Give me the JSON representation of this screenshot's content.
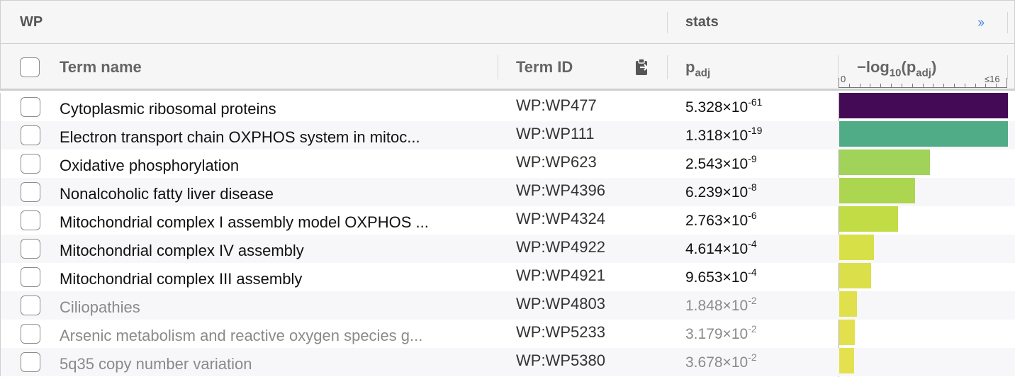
{
  "header": {
    "source_title": "WP",
    "stats_title": "stats",
    "expand_glyph": "››"
  },
  "columns": {
    "term_name": "Term name",
    "term_id": "Term ID",
    "padj_main": "p",
    "padj_sub": "adj",
    "log_main": "−log",
    "log_sub": "10",
    "log_open": "(p",
    "log_inner_sub": "adj",
    "log_close": ")",
    "axis_min": "0",
    "axis_max": "≤16"
  },
  "icons": {
    "clipboard": "clipboard-icon",
    "expand": "double-chevron-right-icon"
  },
  "chart_data": {
    "type": "bar",
    "axis_range": [
      0,
      16
    ],
    "bars": [
      {
        "term": "Cytoplasmic ribosomal proteins",
        "value": 16,
        "color": "#440a55"
      },
      {
        "term": "Electron transport chain OXPHOS system in mitoc...",
        "value": 16,
        "color": "#4fac87"
      },
      {
        "term": "Oxidative phosphorylation",
        "value": 8.6,
        "color": "#a1d25a"
      },
      {
        "term": "Nonalcoholic fatty liver disease",
        "value": 7.2,
        "color": "#acd64f"
      },
      {
        "term": "Mitochondrial complex I assembly model OXPHOS ...",
        "value": 5.6,
        "color": "#c2dc45"
      },
      {
        "term": "Mitochondrial complex IV assembly",
        "value": 3.3,
        "color": "#d7e047"
      },
      {
        "term": "Mitochondrial complex III assembly",
        "value": 3.0,
        "color": "#dbe04a"
      },
      {
        "term": "Ciliopathies",
        "value": 1.7,
        "color": "#e0e04c"
      },
      {
        "term": "Arsenic metabolism and reactive oxygen species g...",
        "value": 1.5,
        "color": "#e3e04e"
      },
      {
        "term": "5q35 copy number variation",
        "value": 1.4,
        "color": "#e4e150"
      }
    ]
  },
  "rows": [
    {
      "term": "Cytoplasmic ribosomal proteins",
      "id": "WP:WP477",
      "p_mant": "5.328×10",
      "p_exp": "-61",
      "dim": false
    },
    {
      "term": "Electron transport chain OXPHOS system in mitoc...",
      "id": "WP:WP111",
      "p_mant": "1.318×10",
      "p_exp": "-19",
      "dim": false
    },
    {
      "term": "Oxidative phosphorylation",
      "id": "WP:WP623",
      "p_mant": "2.543×10",
      "p_exp": "-9",
      "dim": false
    },
    {
      "term": "Nonalcoholic fatty liver disease",
      "id": "WP:WP4396",
      "p_mant": "6.239×10",
      "p_exp": "-8",
      "dim": false
    },
    {
      "term": "Mitochondrial complex I assembly model OXPHOS ...",
      "id": "WP:WP4324",
      "p_mant": "2.763×10",
      "p_exp": "-6",
      "dim": false
    },
    {
      "term": "Mitochondrial complex IV assembly",
      "id": "WP:WP4922",
      "p_mant": "4.614×10",
      "p_exp": "-4",
      "dim": false
    },
    {
      "term": "Mitochondrial complex III assembly",
      "id": "WP:WP4921",
      "p_mant": "9.653×10",
      "p_exp": "-4",
      "dim": false
    },
    {
      "term": "Ciliopathies",
      "id": "WP:WP4803",
      "p_mant": "1.848×10",
      "p_exp": "-2",
      "dim": true
    },
    {
      "term": "Arsenic metabolism and reactive oxygen species g...",
      "id": "WP:WP5233",
      "p_mant": "3.179×10",
      "p_exp": "-2",
      "dim": true
    },
    {
      "term": "5q35 copy number variation",
      "id": "WP:WP5380",
      "p_mant": "3.678×10",
      "p_exp": "-2",
      "dim": true
    }
  ]
}
